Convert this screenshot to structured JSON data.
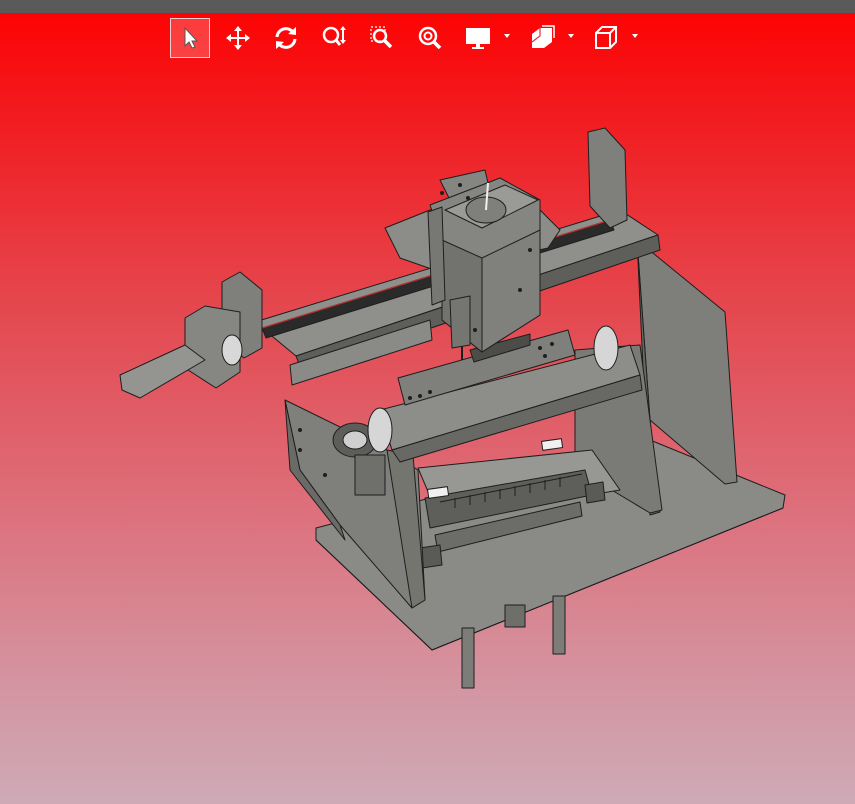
{
  "window": {
    "title_bar_color": "#5a5a5a"
  },
  "viewport": {
    "background_top": "#ff0000",
    "background_bottom": "#ceaab7"
  },
  "toolbar": {
    "tools": [
      {
        "id": "select",
        "icon": "select-pointer-icon",
        "active": true
      },
      {
        "id": "pan",
        "icon": "pan-move-icon",
        "active": false
      },
      {
        "id": "rotate",
        "icon": "rotate-icon",
        "active": false
      },
      {
        "id": "zoom",
        "icon": "zoom-icon",
        "active": false
      },
      {
        "id": "zoom-window",
        "icon": "zoom-window-icon",
        "active": false
      },
      {
        "id": "zoom-fit",
        "icon": "zoom-fit-icon",
        "active": false
      },
      {
        "id": "display-mode",
        "icon": "display-monitor-icon",
        "has_dropdown": true
      },
      {
        "id": "section-view",
        "icon": "section-view-icon",
        "has_dropdown": true
      },
      {
        "id": "view-orientation",
        "icon": "view-cube-icon",
        "has_dropdown": true
      }
    ]
  },
  "model": {
    "description_icon": "cnc-gantry-assembly-model",
    "part_color": "#8f908c",
    "edge_color": "#1e1e1e"
  }
}
